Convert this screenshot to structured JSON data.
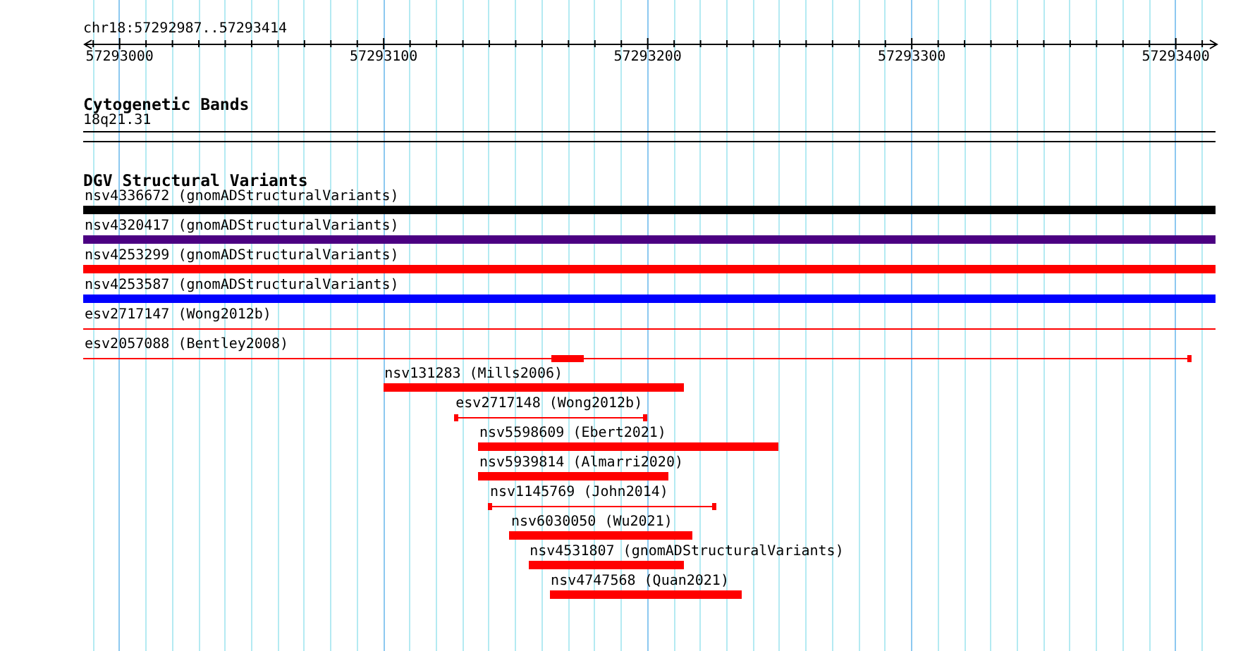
{
  "ruler": {
    "range": "chr18:57292987..57293414",
    "tick_labels": [
      "57293000",
      "57293100",
      "57293200",
      "57293300",
      "57293400"
    ]
  },
  "tracks": [
    {
      "title": "Cytogenetic Bands",
      "kind": "bands",
      "band": "18q21.31"
    },
    {
      "title": "DGV Structural Variants",
      "kind": "features",
      "features": [
        {
          "label": "nsv4336672 (gnomADStructuralVariants)",
          "kind": "bar",
          "color": "#000000"
        },
        {
          "label": "nsv4320417 (gnomADStructuralVariants)",
          "kind": "bar",
          "color": "#4b0082"
        },
        {
          "label": "nsv4253299 (gnomADStructuralVariants)",
          "kind": "bar",
          "color": "#ff0000"
        },
        {
          "label": "nsv4253587 (gnomADStructuralVariants)",
          "kind": "bar",
          "color": "#0000ff"
        },
        {
          "label": "esv2717147 (Wong2012b)",
          "kind": "line",
          "color": "#ff0000"
        },
        {
          "label": "esv2057088 (Bentley2008)",
          "kind": "line",
          "color": "#ff0000"
        },
        {
          "label": "nsv131283 (Mills2006)",
          "kind": "bar",
          "color": "#ff0000"
        },
        {
          "label": "esv2717148 (Wong2012b)",
          "kind": "line",
          "color": "#ff0000"
        },
        {
          "label": "nsv5598609 (Ebert2021)",
          "kind": "bar",
          "color": "#ff0000"
        },
        {
          "label": "nsv5939814 (Almarri2020)",
          "kind": "bar",
          "color": "#ff0000"
        },
        {
          "label": "nsv1145769 (John2014)",
          "kind": "line",
          "color": "#ff0000"
        },
        {
          "label": "nsv6030050 (Wu2021)",
          "kind": "bar",
          "color": "#ff0000"
        },
        {
          "label": "nsv4531807 (gnomADStructuralVariants)",
          "kind": "bar",
          "color": "#ff0000"
        },
        {
          "label": "nsv4747568 (Quan2021)",
          "kind": "bar",
          "color": "#ff0000"
        }
      ]
    }
  ]
}
